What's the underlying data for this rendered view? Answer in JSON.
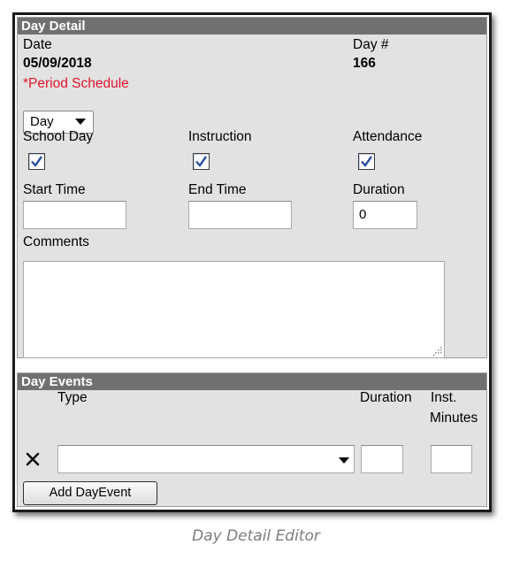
{
  "day_detail": {
    "header": "Day Detail",
    "date_label": "Date",
    "date_value": "05/09/2018",
    "day_num_label": "Day #",
    "day_num_value": "166",
    "period_schedule_label": "*Period Schedule",
    "period_schedule_value": "Day",
    "school_day_label": "School Day",
    "school_day_checked": true,
    "instruction_label": "Instruction",
    "instruction_checked": true,
    "attendance_label": "Attendance",
    "attendance_checked": true,
    "start_time_label": "Start Time",
    "start_time_value": "",
    "end_time_label": "End Time",
    "end_time_value": "",
    "duration_label": "Duration",
    "duration_value": "0",
    "comments_label": "Comments",
    "comments_value": ""
  },
  "day_events": {
    "header": "Day Events",
    "type_label": "Type",
    "duration_label": "Duration",
    "inst_label": "Inst.",
    "minutes_label": "Minutes",
    "type_value": "",
    "duration_value": "",
    "inst_minutes_value": "",
    "add_button": "Add DayEvent"
  },
  "caption": "Day Detail Editor",
  "colors": {
    "panel_bg": "#e2e2e2",
    "header_bg": "#707070",
    "required_text": "#e0142c",
    "caption_text": "#7d7d7d"
  },
  "icons": {
    "remove": "close-x-icon",
    "dropdown": "caret-down-icon",
    "check": "checkmark-icon",
    "resize": "resize-grip-icon"
  }
}
